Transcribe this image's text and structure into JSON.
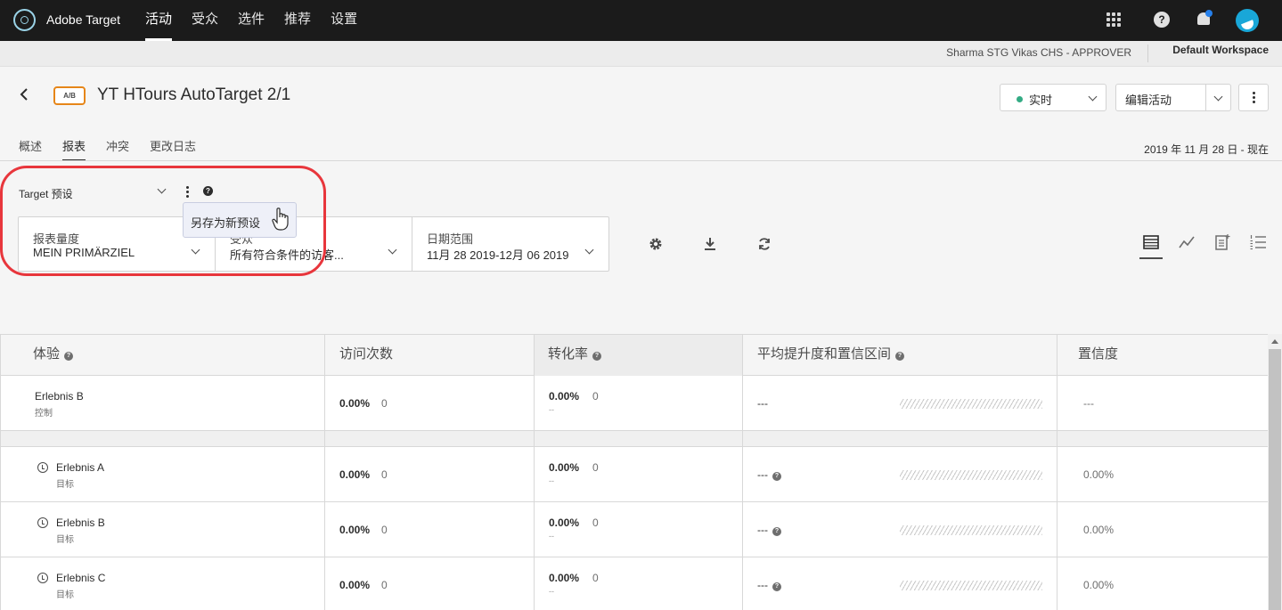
{
  "app": {
    "name": "Adobe Target"
  },
  "topnav": {
    "items": [
      "活动",
      "受众",
      "选件",
      "推荐",
      "设置"
    ]
  },
  "workspace": {
    "user": "Sharma STG Vikas CHS - APPROVER",
    "name": "Default Workspace"
  },
  "header": {
    "badge": "A/B",
    "title": "YT HTours AutoTarget 2/1",
    "status": "实时",
    "edit_label": "编辑活动",
    "status_color": "#33ab84"
  },
  "tabs": [
    "概述",
    "报表",
    "冲突",
    "更改日志"
  ],
  "date_now": "2019 年 11 月 28 日 - 现在",
  "preset": {
    "label": "Target 预设",
    "tooltip": "另存为新预设"
  },
  "filters": [
    {
      "label": "报表量度",
      "value": "MEIN PRIMÄRZIEL"
    },
    {
      "label": "受众",
      "value": "所有符合条件的访客..."
    },
    {
      "label": "日期范围",
      "value": "11月 28 2019-12月 06 2019"
    }
  ],
  "icons": [
    "gear-icon",
    "download-icon",
    "refresh-icon",
    "table-view-icon",
    "graph-view-icon",
    "clipboard-view-icon",
    "list-view-icon"
  ],
  "table": {
    "headers": [
      "体验",
      "访问次数",
      "转化率",
      "平均提升度和置信区间",
      "置信度"
    ],
    "control": {
      "name": "Erlebnis B",
      "sub": "控制",
      "visits_pct": "0.00%",
      "visits_cnt": "0",
      "conv_pct": "0.00%",
      "conv_cnt": "0",
      "conv_dash": "--",
      "lift": "---",
      "confidence": "---"
    },
    "rows": [
      {
        "name": "Erlebnis A",
        "sub": "目标",
        "visits_pct": "0.00%",
        "visits_cnt": "0",
        "conv_pct": "0.00%",
        "conv_cnt": "0",
        "conv_dash": "--",
        "lift": "---",
        "confidence": "0.00%"
      },
      {
        "name": "Erlebnis B",
        "sub": "目标",
        "visits_pct": "0.00%",
        "visits_cnt": "0",
        "conv_pct": "0.00%",
        "conv_cnt": "0",
        "conv_dash": "--",
        "lift": "---",
        "confidence": "0.00%"
      },
      {
        "name": "Erlebnis C",
        "sub": "目标",
        "visits_pct": "0.00%",
        "visits_cnt": "0",
        "conv_pct": "0.00%",
        "conv_cnt": "0",
        "conv_dash": "--",
        "lift": "---",
        "confidence": "0.00%"
      }
    ]
  }
}
